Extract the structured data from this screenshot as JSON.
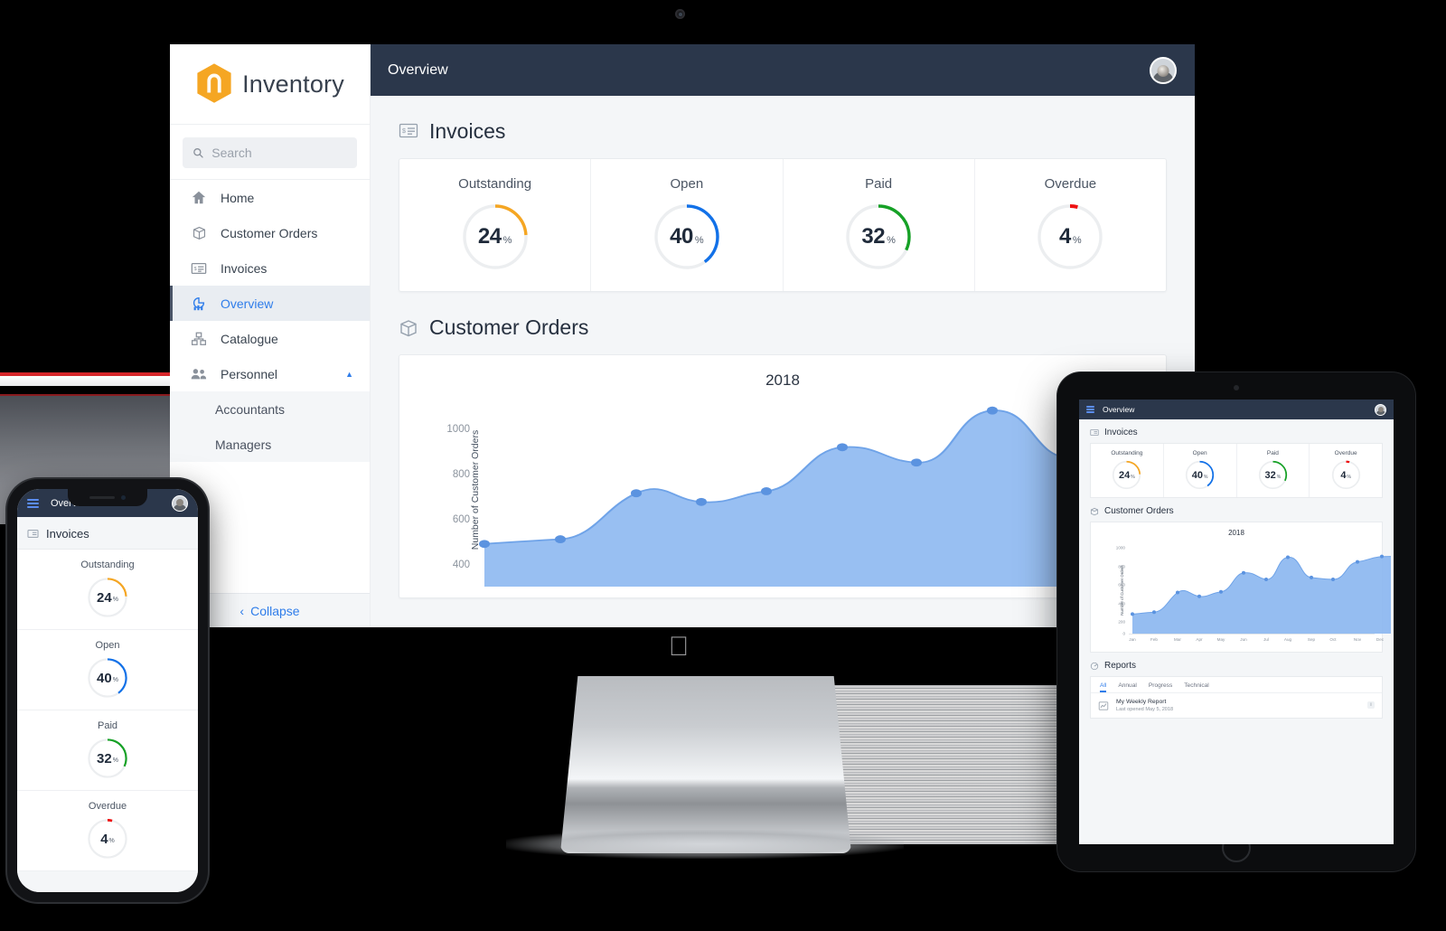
{
  "brand": {
    "name": "Inventory",
    "logo_icon": "hexagon-box-icon",
    "accent": "#f5a623"
  },
  "search": {
    "placeholder": "Search",
    "value": "",
    "icon": "search-icon"
  },
  "sidebar": {
    "items": [
      {
        "label": "Home",
        "icon": "home-icon",
        "active": false
      },
      {
        "label": "Customer Orders",
        "icon": "box-icon",
        "active": false
      },
      {
        "label": "Invoices",
        "icon": "invoice-icon",
        "active": false
      },
      {
        "label": "Overview",
        "icon": "chart-pie-icon",
        "active": true
      },
      {
        "label": "Catalogue",
        "icon": "catalogue-icon",
        "active": false
      },
      {
        "label": "Personnel",
        "icon": "people-icon",
        "active": false,
        "expanded": true
      }
    ],
    "subitems": [
      {
        "label": "Accountants"
      },
      {
        "label": "Managers"
      }
    ],
    "collapse_label": "Collapse",
    "collapse_icon": "chevron-left-icon"
  },
  "topbar": {
    "title": "Overview",
    "avatar_icon": "user-avatar",
    "menu_icon": "hamburger-icon"
  },
  "invoices": {
    "section_title": "Invoices",
    "section_icon": "invoice-icon",
    "kpis": [
      {
        "label": "Outstanding",
        "value": "24",
        "unit": "%",
        "percent": 24,
        "color": "#f5a623"
      },
      {
        "label": "Open",
        "value": "40",
        "unit": "%",
        "percent": 40,
        "color": "#1271e8"
      },
      {
        "label": "Paid",
        "value": "32",
        "unit": "%",
        "percent": 32,
        "color": "#16a126"
      },
      {
        "label": "Overdue",
        "value": "4",
        "unit": "%",
        "percent": 4,
        "color": "#ee1111"
      }
    ]
  },
  "customer_orders": {
    "section_title": "Customer Orders",
    "section_icon": "box-icon"
  },
  "chart_data": {
    "type": "area",
    "title": "2018",
    "xlabel": "",
    "ylabel": "Number of Customer Orders",
    "categories": [
      "Jan",
      "Feb",
      "Mar",
      "Apr",
      "May",
      "Jun",
      "Jul",
      "Aug",
      "Sep",
      "Oct",
      "Nov",
      "Dec"
    ],
    "values": [
      220,
      240,
      405,
      365,
      420,
      640,
      580,
      800,
      600,
      580,
      740,
      800
    ],
    "ylim": [
      0,
      1000
    ],
    "yticks": [
      0,
      200,
      400,
      600,
      800,
      1000
    ],
    "grid": false,
    "legend": "none",
    "series_color": "#8ab6f0",
    "point_color": "#5b93e0"
  },
  "reports": {
    "section_title": "Reports",
    "section_icon": "reports-icon",
    "tabs": [
      {
        "label": "All",
        "active": true
      },
      {
        "label": "Annual",
        "active": false
      },
      {
        "label": "Progress",
        "active": false
      },
      {
        "label": "Technical",
        "active": false
      }
    ],
    "items": [
      {
        "title": "My Weekly Report",
        "subtitle": "Last opened May 5, 2018",
        "icon": "chart-report-icon",
        "action_icon": "info-icon",
        "action_label": "i"
      }
    ]
  },
  "devices": {
    "apple_logo": "apple-logo-icon"
  }
}
